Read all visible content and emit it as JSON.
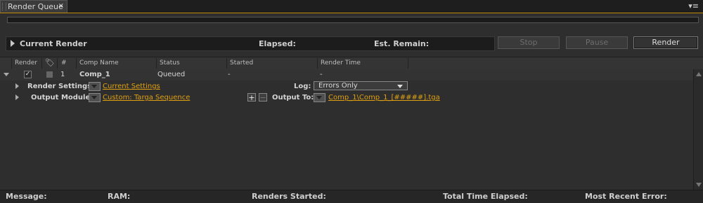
{
  "tab": {
    "title": "Render Queue",
    "close": "×",
    "menu": "▾≡"
  },
  "current_render": {
    "title": "Current Render",
    "elapsed_label": "Elapsed:",
    "remain_label": "Est. Remain:"
  },
  "buttons": {
    "stop": "Stop",
    "pause": "Pause",
    "render": "Render"
  },
  "columns": [
    "Render",
    "#",
    "Comp Name",
    "Status",
    "Started",
    "Render Time"
  ],
  "item": {
    "number": "1",
    "comp_name": "Comp_1",
    "status": "Queued",
    "started": "-",
    "render_time": "-",
    "render_settings_label": "Render Settings:",
    "render_settings_value": "Current Settings",
    "log_label": "Log:",
    "log_value": "Errors Only",
    "output_module_label": "Output Module:",
    "output_module_value": "Custom: Targa Sequence",
    "output_to_label": "Output To:",
    "output_to_value": "Comp_1\\Comp_1_[#####].tga"
  },
  "footer": {
    "message": "Message:",
    "ram": "RAM:",
    "renders_started": "Renders Started:",
    "total_time": "Total Time Elapsed:",
    "recent_error": "Most Recent Error:"
  },
  "colors": {
    "accent": "#e0a010",
    "panel": "#2e2e2e",
    "tab_underline": "#c28b00"
  }
}
